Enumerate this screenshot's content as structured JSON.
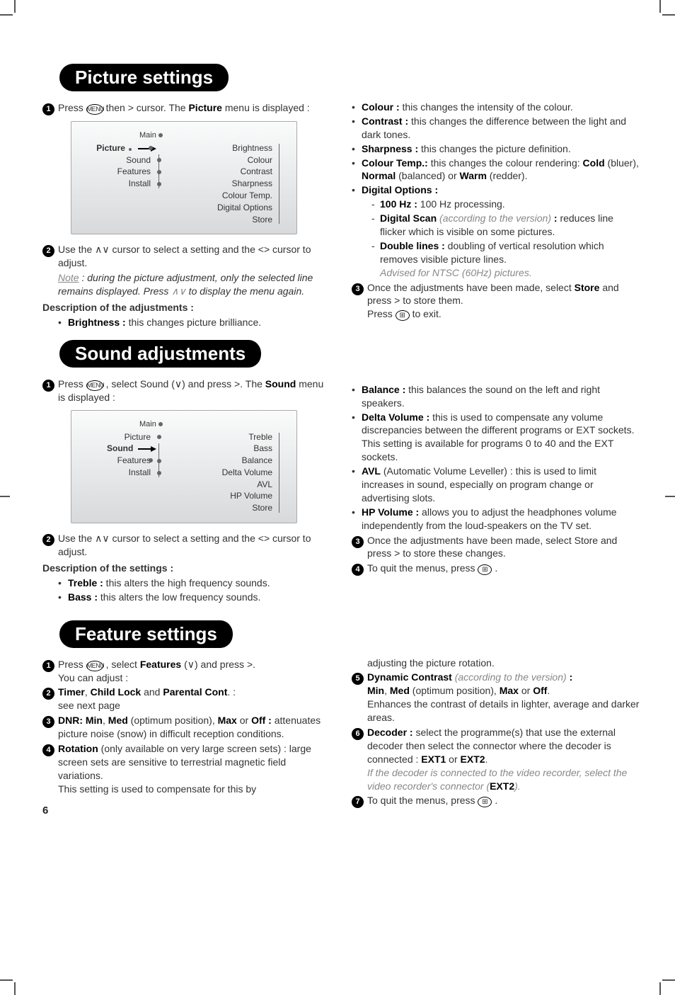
{
  "page_number": "6",
  "sections": {
    "picture": {
      "title": "Picture settings",
      "step1_a": "Press ",
      "step1_b": " then ",
      "step1_c": " cursor. The ",
      "step1_d": "Picture",
      "step1_e": " menu is displayed :",
      "screenshot": {
        "main_label": "Main",
        "left_items": [
          "Picture",
          "Sound",
          "Features",
          "Install"
        ],
        "left_selected_index": 0,
        "right_items": [
          "Brightness",
          "Colour",
          "Contrast",
          "Sharpness",
          "Colour Temp.",
          "Digital Options",
          "Store"
        ]
      },
      "step2_a": "Use the ",
      "step2_b": " cursor to select a setting and the ",
      "step2_c": " cursor to adjust.",
      "note_label": "Note",
      "note_text": " : during the picture adjustment, only the selected line remains displayed. Press ",
      "note_text_b": " to display the menu again.",
      "desc_heading": "Description of the adjustments :",
      "left_bullets": {
        "brightness": {
          "label": "Brightness :",
          "text": " this changes picture brilliance."
        }
      },
      "right_bullets": {
        "colour": {
          "label": "Colour :",
          "text": " this changes the intensity of the colour."
        },
        "contrast": {
          "label": "Contrast :",
          "text": " this changes the difference between the light and dark tones."
        },
        "sharpness": {
          "label": "Sharpness :",
          "text": " this changes the picture definition."
        },
        "ctemp": {
          "label": "Colour Temp.:",
          "text_a": " this changes the colour rendering: ",
          "cold": "Cold",
          "t1": " (bluer), ",
          "normal": "Normal",
          "t2": " (balanced) or ",
          "warm": "Warm",
          "t3": " (redder)."
        },
        "digopt": {
          "label": "Digital Options :",
          "hz100": {
            "label": "100 Hz :",
            "text": " 100 Hz processing."
          },
          "dscan": {
            "label": "Digital Scan",
            "version": " (according to the version) ",
            "colon": ":",
            "text": " reduces line flicker which is visible on some pictures."
          },
          "dbl": {
            "label": "Double lines :",
            "text": " doubling of vertical resolution which removes visible picture lines.",
            "advised": "Advised for NTSC (60Hz) pictures."
          }
        }
      },
      "step3_a": "Once the adjustments have been made, select ",
      "step3_store": "Store",
      "step3_b": " and press ",
      "step3_c": " to store them.",
      "step3_d": "Press ",
      "step3_e": " to exit."
    },
    "sound": {
      "title": "Sound adjustments",
      "step1_a": "Press ",
      "step1_b": ", select Sound (",
      "step1_c": ") and press ",
      "step1_d": ". The ",
      "step1_e": "Sound",
      "step1_f": " menu is displayed :",
      "screenshot": {
        "main_label": "Main",
        "left_items": [
          "Picture",
          "Sound",
          "Features",
          "Install"
        ],
        "left_selected_index": 1,
        "right_items": [
          "Treble",
          "Bass",
          "Balance",
          "Delta Volume",
          "AVL",
          "HP Volume",
          "Store"
        ]
      },
      "step2_a": "Use the ",
      "step2_b": " cursor to select a setting and the ",
      "step2_c": " cursor to adjust.",
      "desc_heading": "Description of the settings :",
      "left_bullets": {
        "treble": {
          "label": "Treble :",
          "text": " this alters the high frequency sounds."
        },
        "bass": {
          "label": "Bass :",
          "text": " this alters the low frequency sounds."
        }
      },
      "right_bullets": {
        "balance": {
          "label": "Balance :",
          "text": " this balances the sound on the left and right speakers."
        },
        "delta": {
          "label": "Delta Volume :",
          "text": " this is used to compensate any volume discrepancies between the different programs or EXT sockets.",
          "text2": "This setting is available for programs 0 to 40 and the EXT sockets."
        },
        "avl": {
          "label": "AVL",
          "paren": " (Automatic Volume Leveller) : ",
          "text": "this is used to limit increases in sound, especially on program change or advertising slots."
        },
        "hp": {
          "label": "HP Volume :",
          "text": " allows you to adjust the headphones volume independently from the loud-speakers on the TV set."
        }
      },
      "step3_a": "Once the adjustments have been made, select Store and press ",
      "step3_b": " to store these changes.",
      "step4_a": "To quit the menus, press ",
      "step4_b": "."
    },
    "feature": {
      "title": "Feature settings",
      "step1_a": "Press ",
      "step1_b": ", select ",
      "step1_bold": "Features",
      "step1_c": " (",
      "step1_d": ") and press ",
      "step1_e": ".",
      "step1_f": "You can adjust :",
      "step2_a": "Timer",
      "step2_b": ", ",
      "step2_c": "Child Lock",
      "step2_d": " and ",
      "step2_e": "Parental Cont",
      "step2_f": ". :",
      "step2_g": "see next page",
      "step3_a": "DNR: Min",
      "step3_b": ", ",
      "step3_c": "Med",
      "step3_d": " (optimum position), ",
      "step3_e": "Max",
      "step3_f": " or ",
      "step3_g": "Off :",
      "step3_h": " attenuates picture noise (snow) in difficult reception conditions.",
      "step4_a": "Rotation",
      "step4_b": " (only available on very large screen sets) : large screen sets are sensitive to terrestrial magnetic field variations.",
      "step4_c": "This setting is used to compensate for this by ",
      "rcol_cont": "adjusting the picture rotation.",
      "step5_a": "Dynamic Contrast",
      "step5_ver": " (according to the version) ",
      "step5_colon": ":",
      "step5_b": "Min",
      "step5_c": ", ",
      "step5_d": "Med",
      "step5_e": " (optimum position), ",
      "step5_f": "Max",
      "step5_g": " or ",
      "step5_h": "Off",
      "step5_i": ".",
      "step5_j": "Enhances the contrast of details in lighter, average and darker areas.",
      "step6_a": "Decoder :",
      "step6_b": " select the programme(s) that use the external decoder then select the connector where the decoder is connected : ",
      "step6_c": "EXT1",
      "step6_d": " or ",
      "step6_e": "EXT2",
      "step6_f": ".",
      "step6_note_a": "If the decoder is connected to the video recorder, select the video recorder's connector (",
      "step6_note_b": "EXT2",
      "step6_note_c": ").",
      "step7_a": "To quit the menus, press ",
      "step7_b": "."
    }
  },
  "glyphs": {
    "menu": "MENU",
    "gt": ">",
    "lt": "<",
    "ltgt": "<>",
    "up": "∧",
    "down": "∨",
    "updown": "∧∨",
    "exit": "⊞"
  }
}
